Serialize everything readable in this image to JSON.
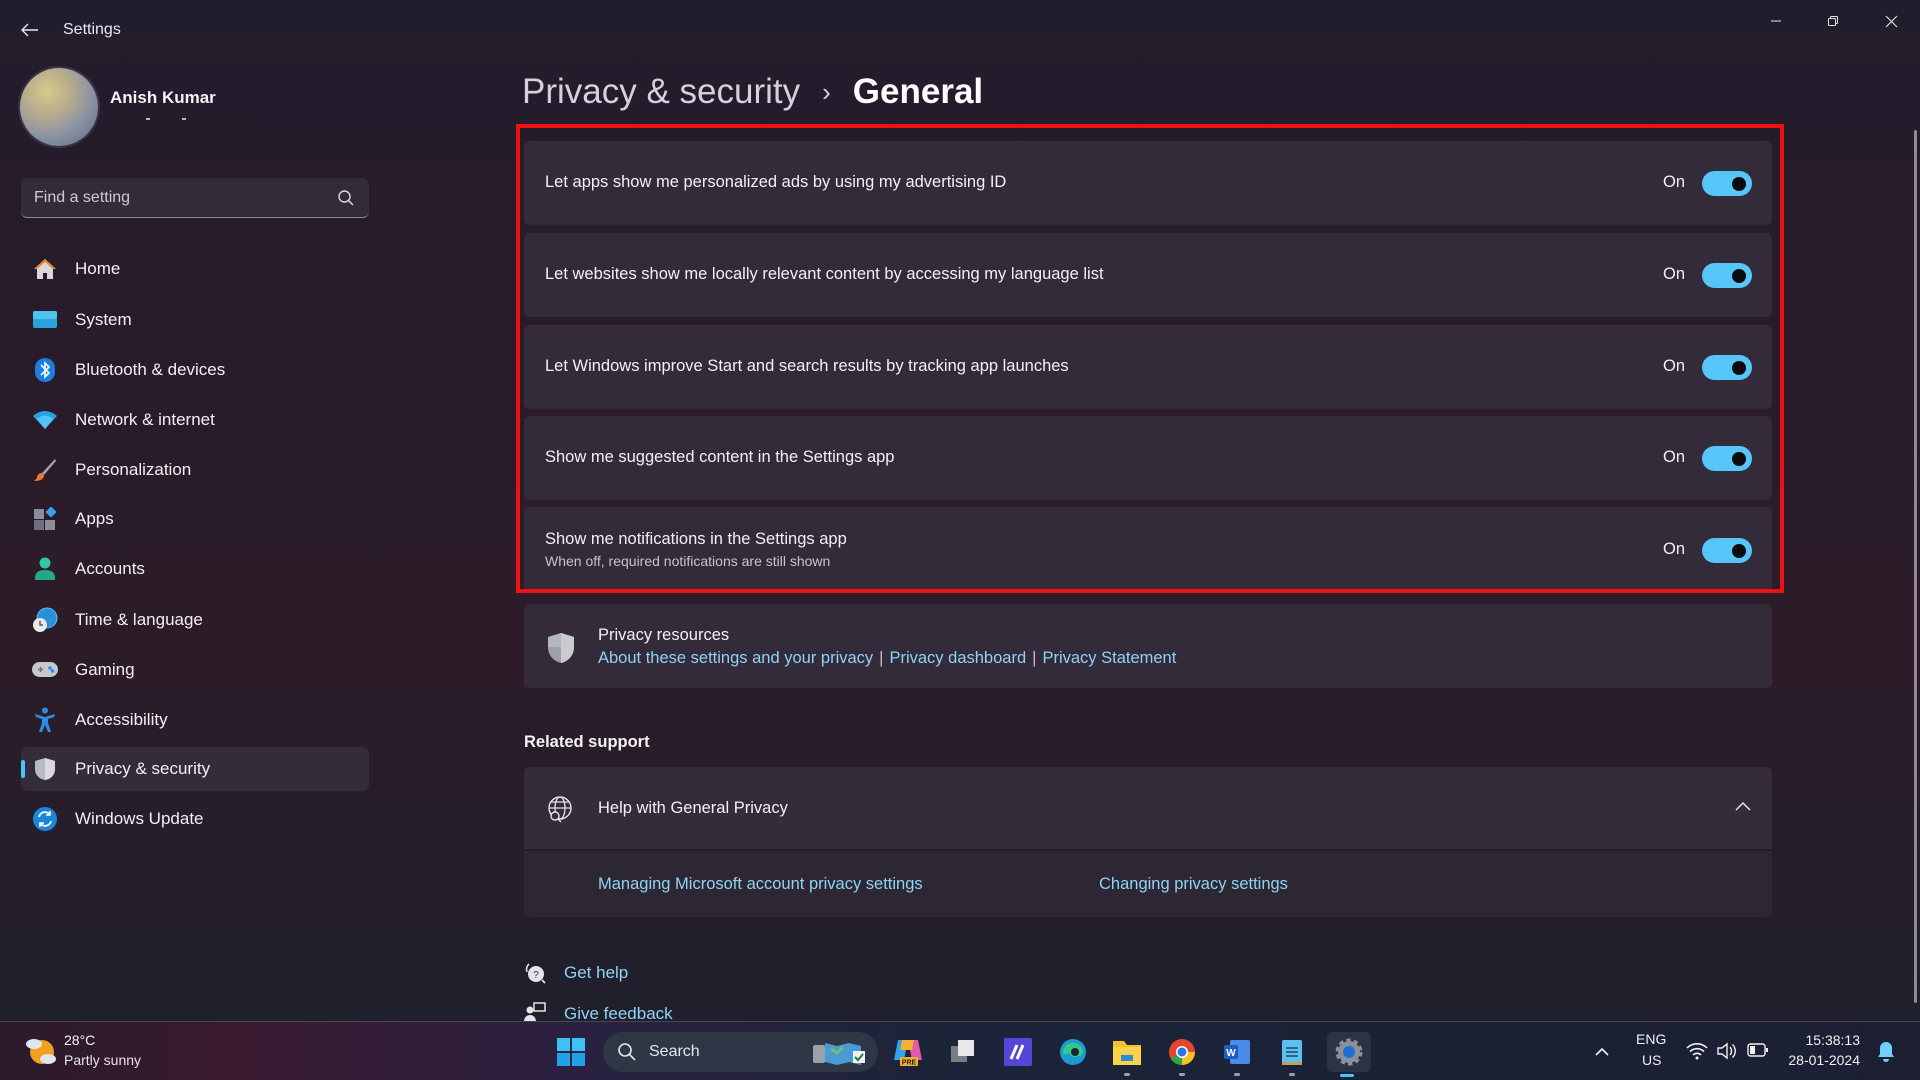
{
  "window": {
    "app_title": "Settings",
    "controls": {
      "minimize": "minimize",
      "maximize": "restore",
      "close": "close"
    }
  },
  "profile": {
    "name": "Anish Kumar"
  },
  "search": {
    "placeholder": "Find a setting"
  },
  "sidebar": {
    "items": [
      {
        "label": "Home",
        "icon": "home-icon",
        "active": false
      },
      {
        "label": "System",
        "icon": "system-icon",
        "active": false
      },
      {
        "label": "Bluetooth & devices",
        "icon": "bluetooth-icon",
        "active": false
      },
      {
        "label": "Network & internet",
        "icon": "wifi-icon",
        "active": false
      },
      {
        "label": "Personalization",
        "icon": "brush-icon",
        "active": false
      },
      {
        "label": "Apps",
        "icon": "apps-icon",
        "active": false
      },
      {
        "label": "Accounts",
        "icon": "accounts-icon",
        "active": false
      },
      {
        "label": "Time & language",
        "icon": "time-language-icon",
        "active": false
      },
      {
        "label": "Gaming",
        "icon": "gaming-icon",
        "active": false
      },
      {
        "label": "Accessibility",
        "icon": "accessibility-icon",
        "active": false
      },
      {
        "label": "Privacy & security",
        "icon": "shield-icon",
        "active": true
      },
      {
        "label": "Windows Update",
        "icon": "windows-update-icon",
        "active": false
      }
    ]
  },
  "breadcrumb": {
    "parent": "Privacy & security",
    "separator": "›",
    "current": "General"
  },
  "settings": [
    {
      "title": "Let apps show me personalized ads by using my advertising ID",
      "description": "",
      "state_label": "On",
      "enabled": true
    },
    {
      "title": "Let websites show me locally relevant content by accessing my language list",
      "description": "",
      "state_label": "On",
      "enabled": true
    },
    {
      "title": "Let Windows improve Start and search results by tracking app launches",
      "description": "",
      "state_label": "On",
      "enabled": true
    },
    {
      "title": "Show me suggested content in the Settings app",
      "description": "",
      "state_label": "On",
      "enabled": true
    },
    {
      "title": "Show me notifications in the Settings app",
      "description": "When off, required notifications are still shown",
      "state_label": "On",
      "enabled": true
    }
  ],
  "privacy_resources": {
    "title": "Privacy resources",
    "links": [
      "About these settings and your privacy",
      "Privacy dashboard",
      "Privacy Statement"
    ],
    "separator": "|"
  },
  "related_support": {
    "label": "Related support",
    "help_title": "Help with General Privacy",
    "expanded": true,
    "links": [
      "Managing Microsoft account privacy settings",
      "Changing privacy settings"
    ]
  },
  "footer": {
    "get_help": "Get help",
    "give_feedback": "Give feedback"
  },
  "taskbar": {
    "weather": {
      "temp": "28°C",
      "condition": "Partly sunny"
    },
    "search_label": "Search",
    "apps": [
      "start",
      "search",
      "copilot-pre",
      "task-view",
      "app-pen",
      "edge",
      "file-explorer",
      "chrome",
      "word",
      "notepad",
      "settings"
    ],
    "tray": {
      "lang_line1": "ENG",
      "lang_line2": "US",
      "time": "15:38:13",
      "date": "28-01-2024"
    }
  },
  "colors": {
    "accent": "#4cc2ff",
    "toggle_on": "#55c6f7",
    "link": "#8fd3f5",
    "highlight_border": "#ee1111"
  }
}
